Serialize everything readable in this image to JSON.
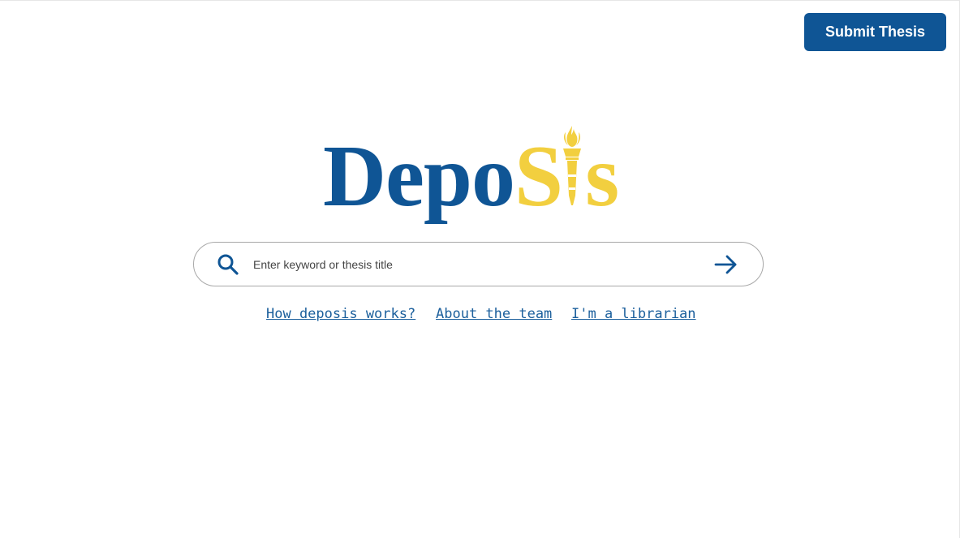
{
  "header": {
    "submit_label": "Submit Thesis"
  },
  "logo": {
    "part1": "Depo",
    "part2": "S",
    "part3": "s",
    "icon": "torch-icon"
  },
  "search": {
    "placeholder": "Enter keyword or thesis title",
    "value": "",
    "search_icon": "search-icon",
    "submit_icon": "arrow-right-icon"
  },
  "links": [
    {
      "label": "How deposis works?"
    },
    {
      "label": "About the team"
    },
    {
      "label": "I'm a librarian"
    }
  ],
  "colors": {
    "brand_blue": "#0f5595",
    "brand_yellow": "#f2cf3f",
    "link_blue": "#1b5f9c"
  }
}
